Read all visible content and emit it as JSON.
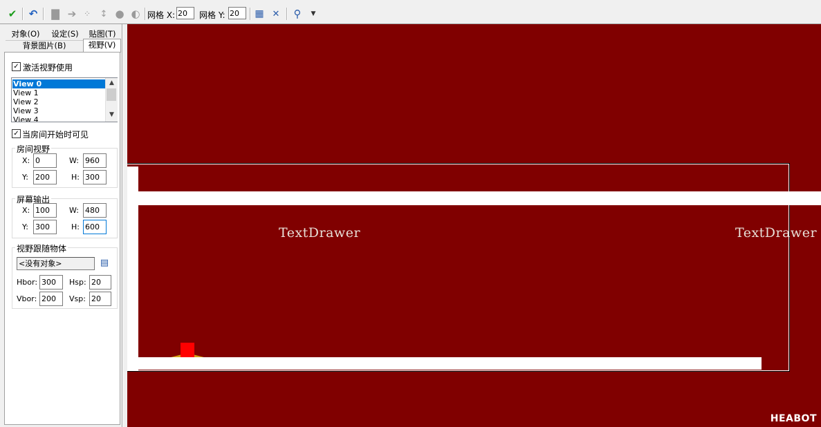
{
  "toolbar": {
    "icons": [
      "check-icon",
      "undo-icon",
      "page-icon",
      "arrow-right-icon",
      "shift-h-icon",
      "shift-v-icon",
      "lock-icon",
      "unlock-icon",
      "grid-icon",
      "iso-grid-icon",
      "zoom-icon",
      "dropdown-icon"
    ],
    "grid_x_label": "网格 X:",
    "grid_x_value": "20",
    "grid_y_label": "网格 Y:",
    "grid_y_value": "20"
  },
  "tabs": {
    "objects": "对象(O)",
    "settings": "设定(S)",
    "tiles": "贴图(T)",
    "backgrounds": "背景图片(B)",
    "views": "视野(V)"
  },
  "views_panel": {
    "enable_views_label": "激活视野使用",
    "enable_views_checked": true,
    "view_list": [
      "View 0",
      "View 1",
      "View 2",
      "View 3",
      "View 4"
    ],
    "selected_view": "View 0",
    "visible_on_start_label": "当房间开始时可见",
    "visible_on_start_checked": true,
    "view_in_room": {
      "title": "房间视野",
      "x_label": "X:",
      "x": "0",
      "w_label": "W:",
      "w": "960",
      "y_label": "Y:",
      "y": "200",
      "h_label": "H:",
      "h": "300"
    },
    "port_on_screen": {
      "title": "屏幕输出",
      "x_label": "X:",
      "x": "100",
      "w_label": "W:",
      "w": "480",
      "y_label": "Y:",
      "y": "300",
      "h_label": "H:",
      "h": "600"
    },
    "object_following": {
      "title": "视野跟随物体",
      "object": "<没有对象>",
      "hbor_label": "Hbor:",
      "hbor": "300",
      "hsp_label": "Hsp:",
      "hsp": "20",
      "vbor_label": "Vbor:",
      "vbor": "200",
      "vsp_label": "Vsp:",
      "vsp": "20"
    }
  },
  "canvas": {
    "background_color": "#800000",
    "instance_label_1": "TextDrawer",
    "instance_label_2": "TextDrawer",
    "watermark": "HEABOT"
  }
}
